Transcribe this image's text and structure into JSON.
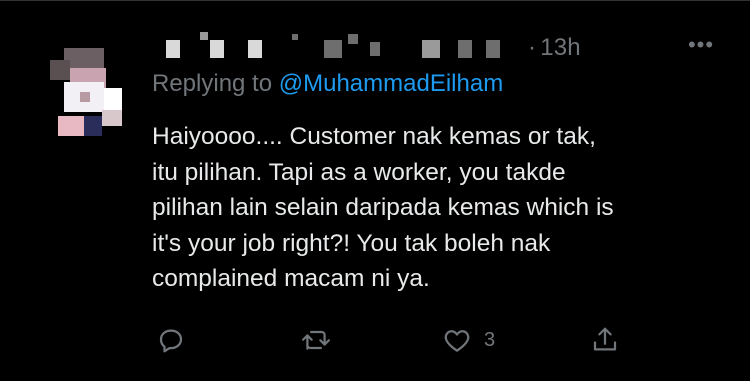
{
  "tweet": {
    "time_separator": "·",
    "time": "13h",
    "more_label": "•••",
    "replying_prefix": "Replying to",
    "replying_handle": "@MuhammadEilham",
    "text": "Haiyoooo.... Customer nak kemas or tak,\nitu pilihan. Tapi as a worker, you takde\npilihan lain selain daripada kemas which is\nit's your job right?! You tak boleh nak\ncomplained macam ni ya.",
    "actions": {
      "reply_icon": "reply-icon",
      "retweet_icon": "retweet-icon",
      "like_icon": "heart-icon",
      "like_count": "3",
      "share_icon": "share-icon"
    }
  },
  "colors": {
    "background": "#000000",
    "text": "#e7e9ea",
    "muted": "#71767b",
    "accent": "#1d9bf0"
  }
}
